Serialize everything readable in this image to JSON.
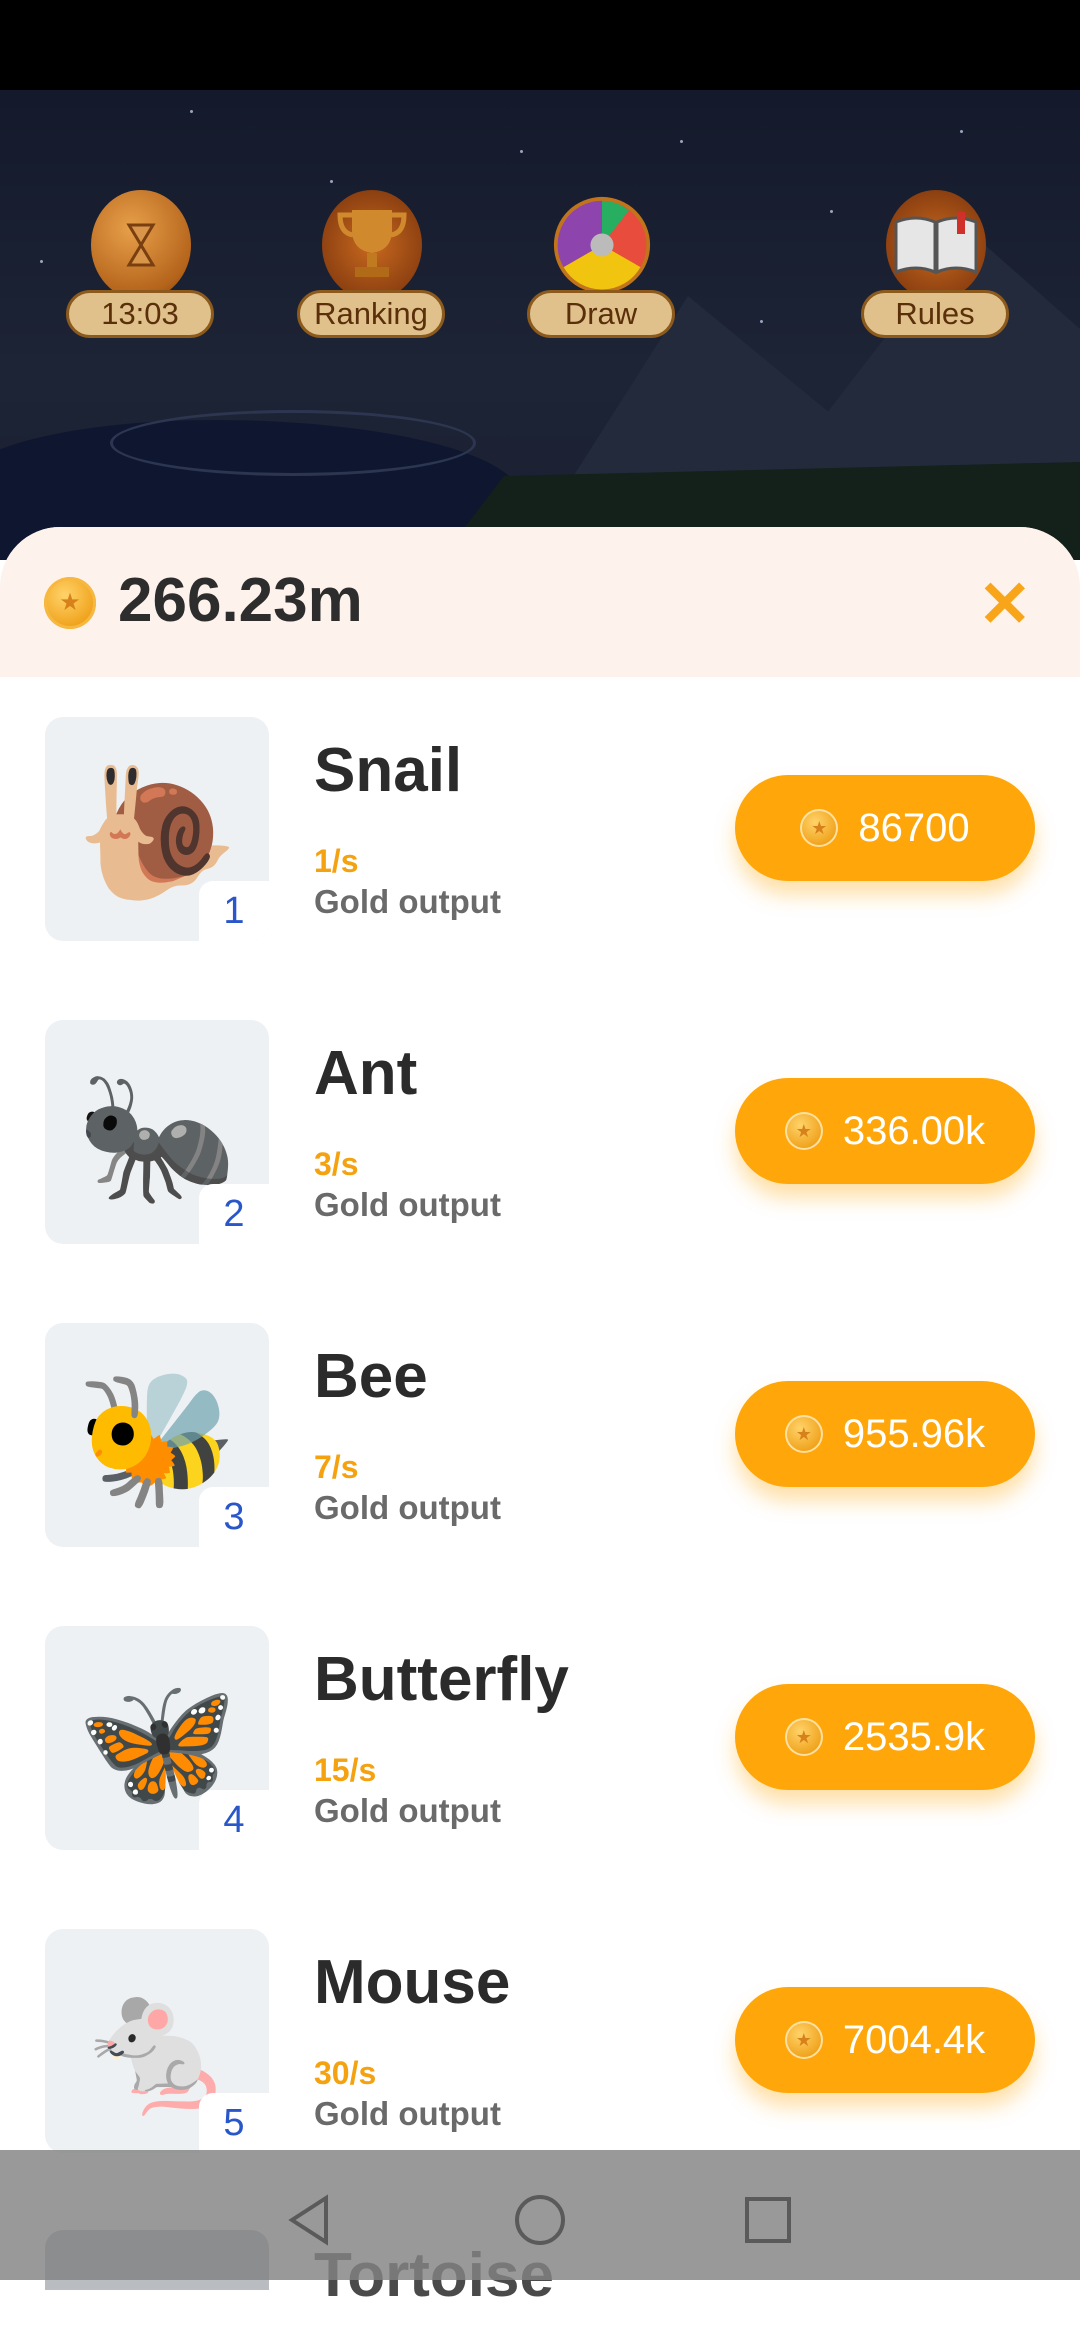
{
  "toolbar": {
    "timer": {
      "label": "13:03",
      "icon": "hourglass-coin-icon"
    },
    "ranking": {
      "label": "Ranking",
      "icon": "trophy-icon"
    },
    "draw": {
      "label": "Draw",
      "icon": "prize-wheel-icon"
    },
    "rules": {
      "label": "Rules",
      "icon": "book-icon"
    }
  },
  "panel": {
    "balance": "266.23m",
    "close_icon": "close-icon"
  },
  "items": [
    {
      "name": "Snail",
      "emoji": "🐌",
      "rank": "1",
      "rate": "1/s",
      "caption": "Gold output",
      "price": "86700"
    },
    {
      "name": "Ant",
      "emoji": "🐜",
      "rank": "2",
      "rate": "3/s",
      "caption": "Gold output",
      "price": "336.00k"
    },
    {
      "name": "Bee",
      "emoji": "🐝",
      "rank": "3",
      "rate": "7/s",
      "caption": "Gold output",
      "price": "955.96k"
    },
    {
      "name": "Butterfly",
      "emoji": "🦋",
      "rank": "4",
      "rate": "15/s",
      "caption": "Gold output",
      "price": "2535.9k"
    },
    {
      "name": "Mouse",
      "emoji": "🐁",
      "rank": "5",
      "rate": "30/s",
      "caption": "Gold output",
      "price": "7004.4k"
    }
  ],
  "peek_item": {
    "name": "Tortoise"
  },
  "colors": {
    "accent": "#ffa70a",
    "rate": "#f4a210",
    "badge_text": "#2956c9",
    "header_bg": "#fdf2ec"
  }
}
